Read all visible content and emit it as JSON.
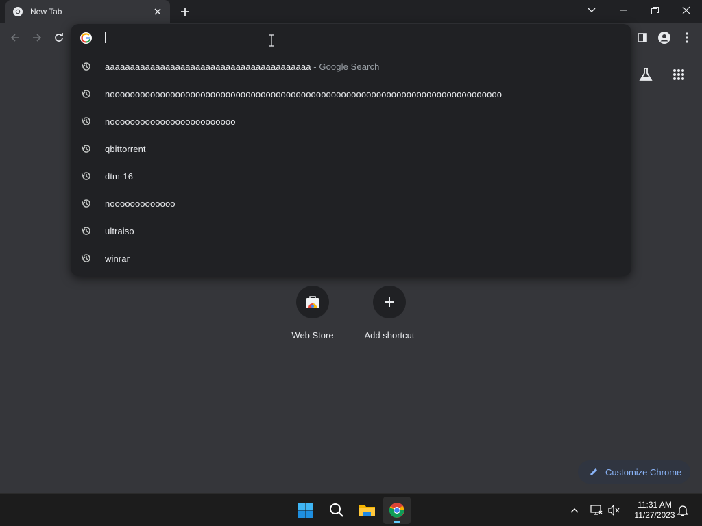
{
  "tab": {
    "title": "New Tab"
  },
  "omnibox": {
    "value": "",
    "suggestions": [
      {
        "text": "aaaaaaaaaaaaaaaaaaaaaaaaaaaaaaaaaaaaaaaaa",
        "description": " - Google Search"
      },
      {
        "text": "noooooooooooooooooooooooooooooooooooooooooooooooooooooooooooooooooooooooooooooo",
        "description": ""
      },
      {
        "text": "nooooooooooooooooooooooooo",
        "description": ""
      },
      {
        "text": "qbittorrent",
        "description": ""
      },
      {
        "text": "dtm-16",
        "description": ""
      },
      {
        "text": "nooooooooooooo",
        "description": ""
      },
      {
        "text": "ultraiso",
        "description": ""
      },
      {
        "text": "winrar",
        "description": ""
      }
    ]
  },
  "shortcuts": [
    {
      "label": "Web Store",
      "icon": "web-store-icon"
    },
    {
      "label": "Add shortcut",
      "icon": "plus-icon"
    }
  ],
  "customize": {
    "label": "Customize Chrome"
  },
  "taskbar": {
    "time": "11:31 AM",
    "date": "11/27/2023"
  },
  "colors": {
    "accent": "#8ab4f8",
    "background": "#35363a",
    "dropdown": "#202124",
    "taskbar": "#1c1c1c"
  }
}
